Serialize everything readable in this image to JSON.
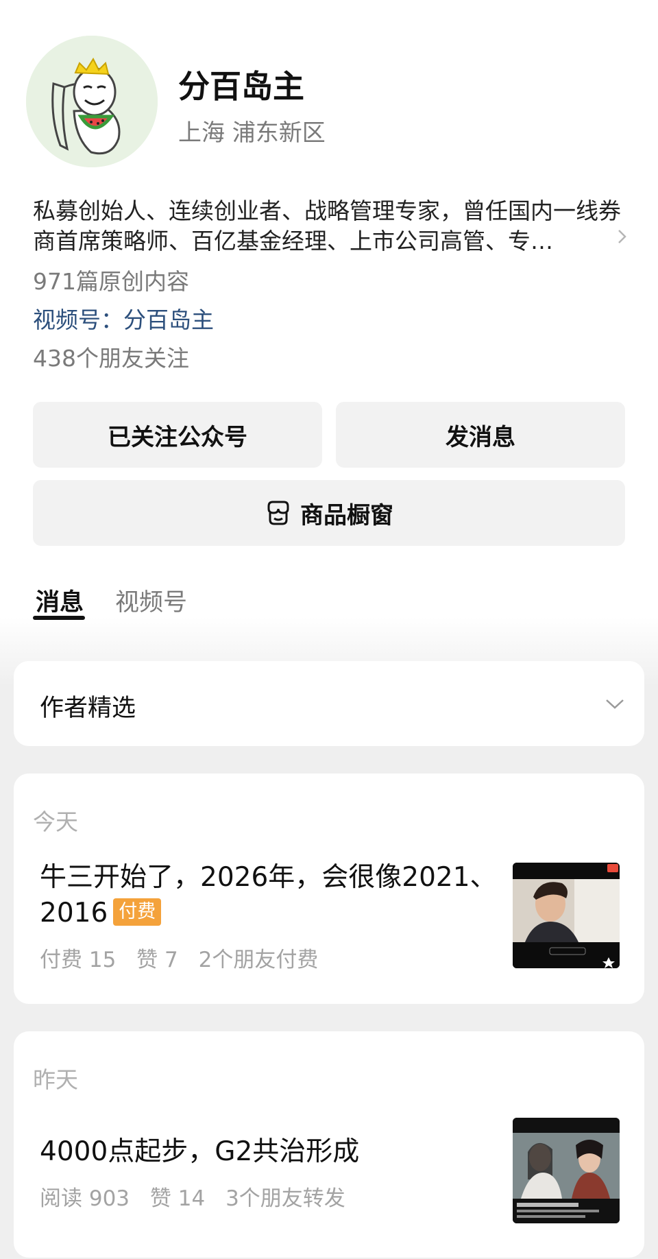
{
  "profile": {
    "name": "分百岛主",
    "location": "上海 浦东新区",
    "bio": "私募创始人、连续创业者、战略管理专家，曾任国内一线券商首席策略师、百亿基金经理、上市公司高管、专…",
    "articles": "971篇原创内容",
    "channel": "视频号：分百岛主",
    "followers": "438个朋友关注"
  },
  "actions": {
    "follow_label": "已关注公众号",
    "message_label": "发消息",
    "shop_label": "商品橱窗",
    "shop_icon": "storefront-icon"
  },
  "tabs": [
    {
      "label": "消息",
      "active": true
    },
    {
      "label": "视频号",
      "active": false
    }
  ],
  "picks": {
    "label": "作者精选",
    "icon": "chevron-down-icon"
  },
  "feed": [
    {
      "day": "今天",
      "title": "牛三开始了，2026年，会很像2021、2016",
      "tag": "付费",
      "meta": [
        "付费 15",
        "赞 7",
        "2个朋友付费"
      ]
    },
    {
      "day": "昨天",
      "title": "4000点起步，G2共治形成",
      "meta": [
        "阅读 903",
        "赞 14",
        "3个朋友转发"
      ]
    }
  ],
  "colors": {
    "accent_link": "#2c4f7c",
    "paid_tag": "#f4a23b",
    "button_bg": "#f2f2f2"
  }
}
